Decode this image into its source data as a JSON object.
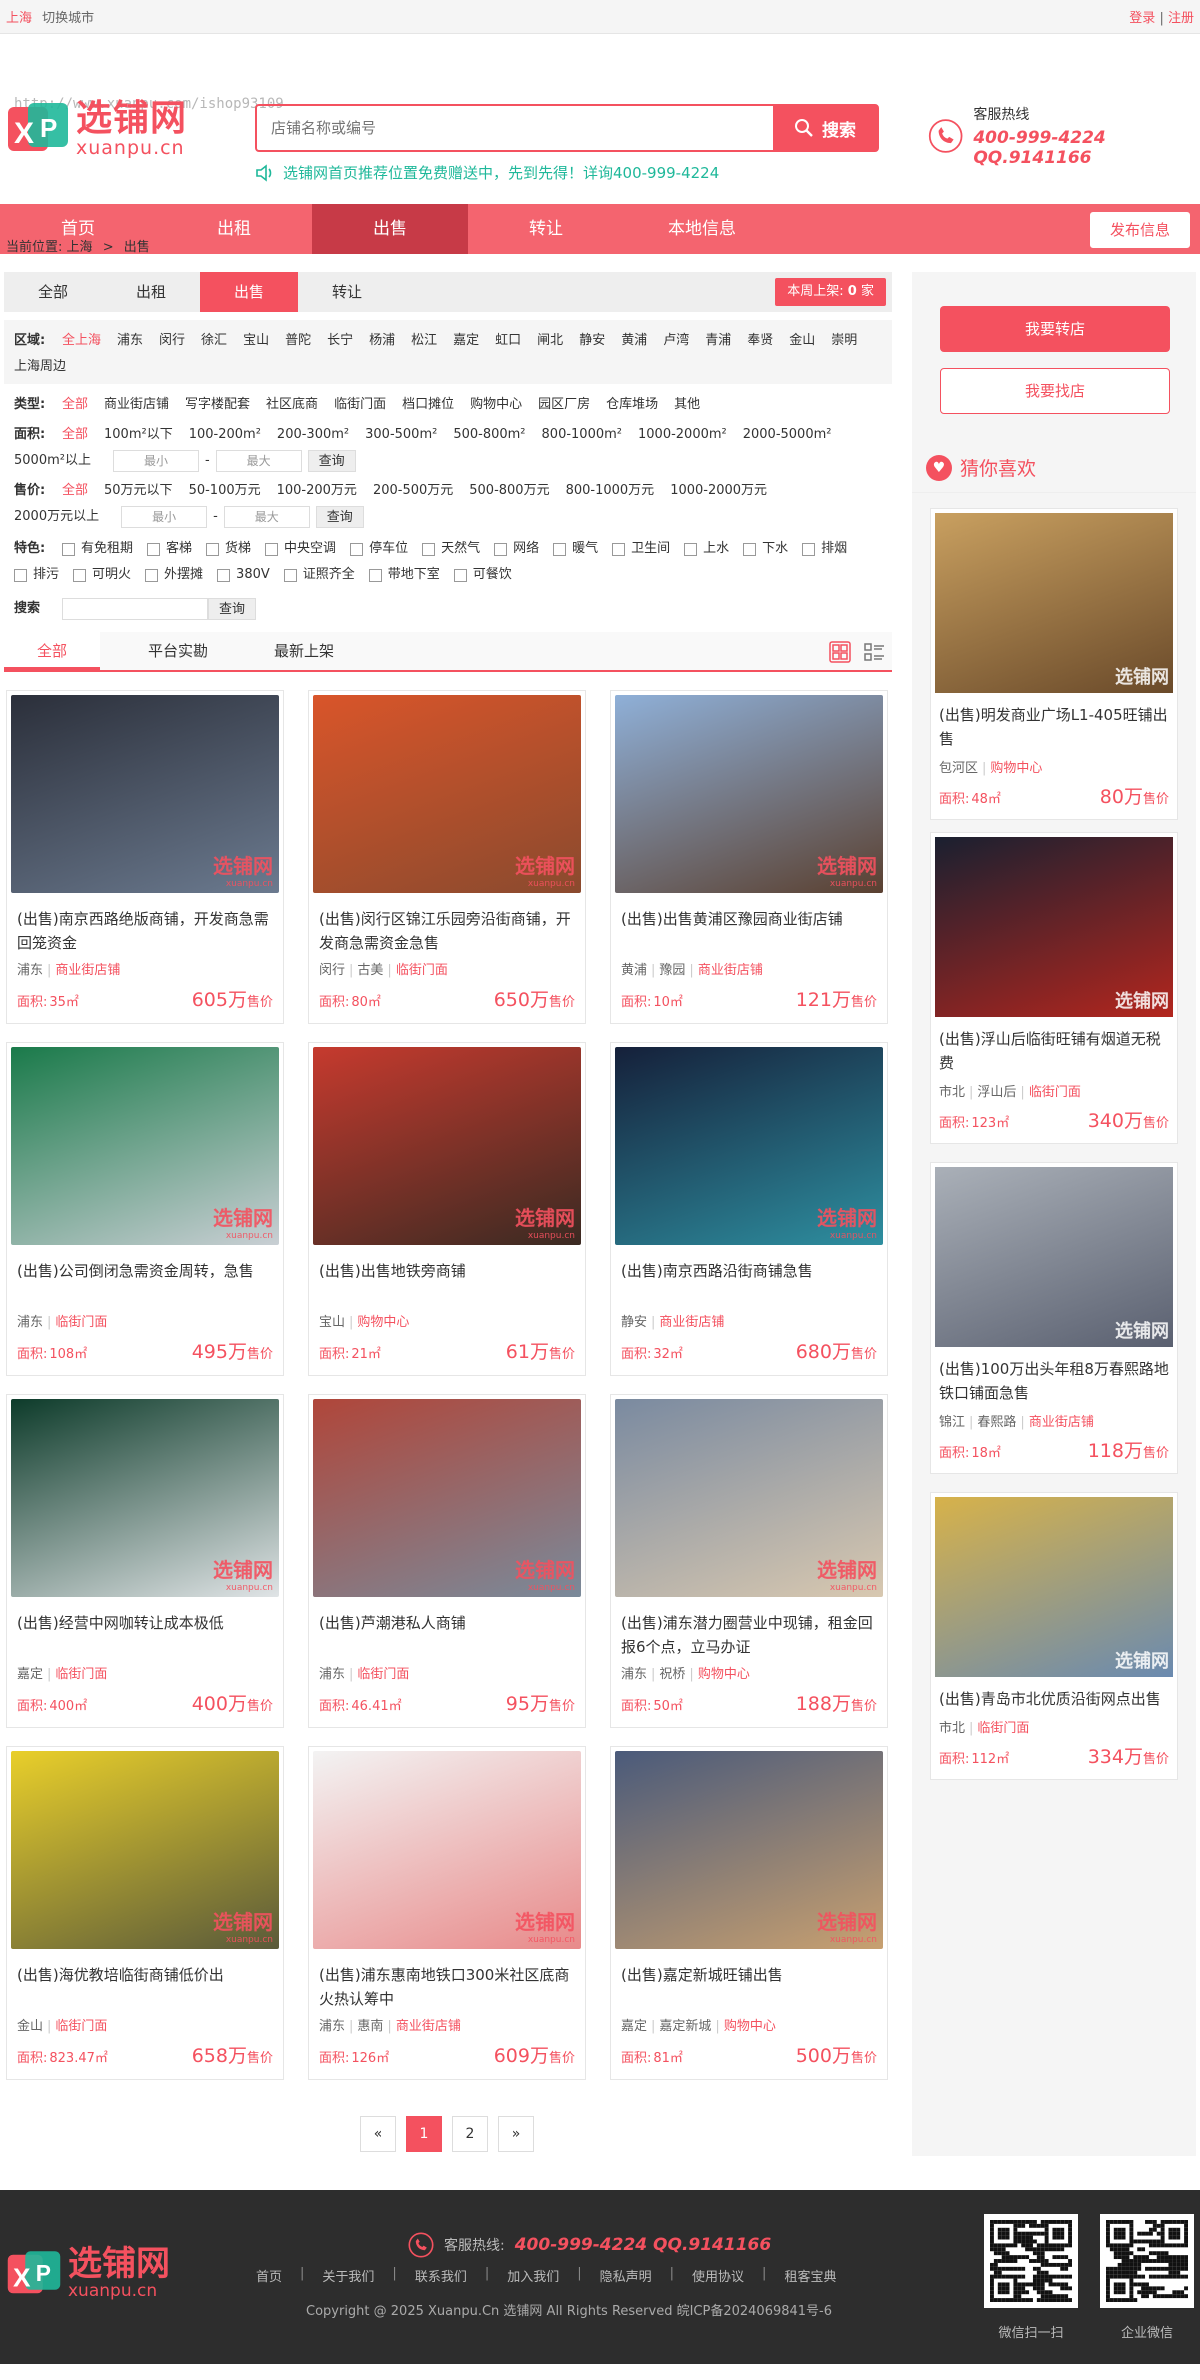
{
  "topbar": {
    "city": "上海",
    "switch_city": "切换城市",
    "login": "登录",
    "sep": "|",
    "register": "注册"
  },
  "header": {
    "logo_cn": "选铺网",
    "logo_en": "xuanpu.cn",
    "watermark_url": "http://www.xuanpu.com/ishop93109",
    "search_placeholder": "店铺名称或编号",
    "search_button": "搜索",
    "notice": "选铺网首页推荐位置免费赠送中，先到先得！详询400-999-4224",
    "hotline_label": "客服热线",
    "hotline_number": "400-999-4224 QQ.9141166"
  },
  "nav": {
    "items": [
      "首页",
      "出租",
      "出售",
      "转让",
      "本地信息"
    ],
    "active_index": 2,
    "publish": "发布信息"
  },
  "breadcrumb": {
    "prefix": "当前位置:",
    "city": "上海",
    "arrow": ">",
    "current": "出售"
  },
  "tabs": {
    "items": [
      "全部",
      "出租",
      "出售",
      "转让"
    ],
    "active_index": 2,
    "weekly_prefix": "本周上架:",
    "weekly_count": "0",
    "weekly_unit": "家"
  },
  "filters": {
    "region_label": "区域:",
    "regions": [
      "全上海",
      "浦东",
      "闵行",
      "徐汇",
      "宝山",
      "普陀",
      "长宁",
      "杨浦",
      "松江",
      "嘉定",
      "虹口",
      "闸北",
      "静安",
      "黄浦",
      "卢湾",
      "青浦",
      "奉贤",
      "金山",
      "崇明",
      "上海周边"
    ],
    "type_label": "类型:",
    "types": [
      "全部",
      "商业街店铺",
      "写字楼配套",
      "社区底商",
      "临街门面",
      "档口摊位",
      "购物中心",
      "园区厂房",
      "仓库堆场",
      "其他"
    ],
    "area_label": "面积:",
    "areas": [
      "全部",
      "100m²以下",
      "100-200m²",
      "200-300m²",
      "300-500m²",
      "500-800m²",
      "800-1000m²",
      "1000-2000m²",
      "2000-5000m²",
      "5000m²以上"
    ],
    "price_label": "售价:",
    "prices": [
      "全部",
      "50万元以下",
      "50-100万元",
      "100-200万元",
      "200-500万元",
      "500-800万元",
      "800-1000万元",
      "1000-2000万元",
      "2000万元以上"
    ],
    "min_placeholder": "最小",
    "max_placeholder": "最大",
    "dash": "-",
    "query": "查询",
    "feature_label": "特色:",
    "features": [
      "有免租期",
      "客梯",
      "货梯",
      "中央空调",
      "停车位",
      "天然气",
      "网络",
      "暖气",
      "卫生间",
      "上水",
      "下水",
      "排烟",
      "排污",
      "可明火",
      "外摆摊",
      "380V",
      "证照齐全",
      "带地下室",
      "可餐饮"
    ],
    "search_label": "搜索"
  },
  "sort": {
    "items": [
      "全部",
      "平台实勘",
      "最新上架"
    ],
    "active_index": 0
  },
  "watermark": {
    "cn": "选铺网",
    "en": "xuanpu.cn"
  },
  "listings": [
    {
      "title": "(出售)南京西路绝版商铺，开发商急需回笼资金",
      "district": "浦东",
      "sub": "",
      "type": "商业街店铺",
      "area_label": "面积:",
      "area": "35㎡",
      "price": "605万",
      "unit": "售价",
      "c1": "#2b2f3a",
      "c2": "#6b7a8f"
    },
    {
      "title": "(出售)闵行区锦江乐园旁沿街商铺，开发商急需资金急售",
      "district": "闵行",
      "sub": "古美",
      "type": "临街门面",
      "area_label": "面积:",
      "area": "80㎡",
      "price": "650万",
      "unit": "售价",
      "c1": "#d9552a",
      "c2": "#8a4a2e"
    },
    {
      "title": "(出售)出售黄浦区豫园商业街店铺",
      "district": "黄浦",
      "sub": "豫园",
      "type": "商业街店铺",
      "area_label": "面积:",
      "area": "10㎡",
      "price": "121万",
      "unit": "售价",
      "c1": "#8fb0d8",
      "c2": "#5a4030"
    },
    {
      "title": "(出售)公司倒闭急需资金周转，急售",
      "district": "浦东",
      "sub": "",
      "type": "临街门面",
      "area_label": "面积:",
      "area": "108㎡",
      "price": "495万",
      "unit": "售价",
      "c1": "#1a7a4a",
      "c2": "#c9cfd4"
    },
    {
      "title": "(出售)出售地铁旁商铺",
      "district": "宝山",
      "sub": "",
      "type": "购物中心",
      "area_label": "面积:",
      "area": "21㎡",
      "price": "61万",
      "unit": "售价",
      "c1": "#c63a2e",
      "c2": "#3a2a22"
    },
    {
      "title": "(出售)南京西路沿街商铺急售",
      "district": "静安",
      "sub": "",
      "type": "商业街店铺",
      "area_label": "面积:",
      "area": "32㎡",
      "price": "680万",
      "unit": "售价",
      "c1": "#15203a",
      "c2": "#2e8fa0"
    },
    {
      "title": "(出售)经营中网咖转让成本极低",
      "district": "嘉定",
      "sub": "",
      "type": "临街门面",
      "area_label": "面积:",
      "area": "400㎡",
      "price": "400万",
      "unit": "售价",
      "c1": "#0d3b2a",
      "c2": "#e0e4e6"
    },
    {
      "title": "(出售)芦潮港私人商铺",
      "district": "浦东",
      "sub": "",
      "type": "临街门面",
      "area_label": "面积:",
      "area": "46.41㎡",
      "price": "95万",
      "unit": "售价",
      "c1": "#b0463a",
      "c2": "#7a8a9a"
    },
    {
      "title": "(出售)浦东潜力圈营业中现铺，租金回报6个点，立马办证",
      "district": "浦东",
      "sub": "祝桥",
      "type": "购物中心",
      "area_label": "面积:",
      "area": "50㎡",
      "price": "188万",
      "unit": "售价",
      "c1": "#7a8aa0",
      "c2": "#d8c8b0"
    },
    {
      "title": "(出售)海优教培临街商铺低价出",
      "district": "金山",
      "sub": "",
      "type": "临街门面",
      "area_label": "面积:",
      "area": "823.47㎡",
      "price": "658万",
      "unit": "售价",
      "c1": "#e9cf2a",
      "c2": "#5a5a3a"
    },
    {
      "title": "(出售)浦东惠南地铁口300米社区底商火热认筹中",
      "district": "浦东",
      "sub": "惠南",
      "type": "商业街店铺",
      "area_label": "面积:",
      "area": "126㎡",
      "price": "609万",
      "unit": "售价",
      "c1": "#f3f3f3",
      "c2": "#e88a8a"
    },
    {
      "title": "(出售)嘉定新城旺铺出售",
      "district": "嘉定",
      "sub": "嘉定新城",
      "type": "购物中心",
      "area_label": "面积:",
      "area": "81㎡",
      "price": "500万",
      "unit": "售价",
      "c1": "#4a5a7a",
      "c2": "#c8a070"
    }
  ],
  "pager": {
    "prev": "«",
    "pages": [
      "1",
      "2"
    ],
    "current": "1",
    "next": "»"
  },
  "side": {
    "btn_transfer": "我要转店",
    "btn_find": "我要找店",
    "guess_title": "猜你喜欢",
    "items": [
      {
        "title": "(出售)明发商业广场L1-405旺铺出售",
        "district": "包河区",
        "sub": "",
        "type": "购物中心",
        "area_label": "面积:",
        "area": "48㎡",
        "price": "80万",
        "unit": "售价",
        "c1": "#c9a060",
        "c2": "#6a4a2a"
      },
      {
        "title": "(出售)浮山后临街旺铺有烟道无税费",
        "district": "市北",
        "sub": "浮山后",
        "type": "临街门面",
        "area_label": "面积:",
        "area": "123㎡",
        "price": "340万",
        "unit": "售价",
        "c1": "#1a2030",
        "c2": "#b3261e"
      },
      {
        "title": "(出售)100万出头年租8万春熙路地铁口铺面急售",
        "district": "锦江",
        "sub": "春熙路",
        "type": "商业街店铺",
        "area_label": "面积:",
        "area": "18㎡",
        "price": "118万",
        "unit": "售价",
        "c1": "#aab0b8",
        "c2": "#5a6070"
      },
      {
        "title": "(出售)青岛市北优质沿街网点出售",
        "district": "市北",
        "sub": "",
        "type": "临街门面",
        "area_label": "面积:",
        "area": "112㎡",
        "price": "334万",
        "unit": "售价",
        "c1": "#d7b24a",
        "c2": "#6a8ab0"
      }
    ]
  },
  "footer": {
    "logo_cn": "选铺网",
    "logo_en": "xuanpu.cn",
    "hotline_label": "客服热线:",
    "hotline_number": "400-999-4224 QQ.9141166",
    "links": [
      "首页",
      "关于我们",
      "联系我们",
      "加入我们",
      "隐私声明",
      "使用协议",
      "租客宝典"
    ],
    "copyright": "Copyright @ 2025 Xuanpu.Cn 选铺网 All Rights Reserved 皖ICP备2024069841号-6",
    "qr1_label": "微信扫一扫",
    "qr2_label": "企业微信"
  },
  "colors": {
    "brand": "#f4515f",
    "nav": "#f4646f",
    "nav_active": "#c73a47",
    "notice": "#1fb89a",
    "footer": "#2d2d2d"
  }
}
